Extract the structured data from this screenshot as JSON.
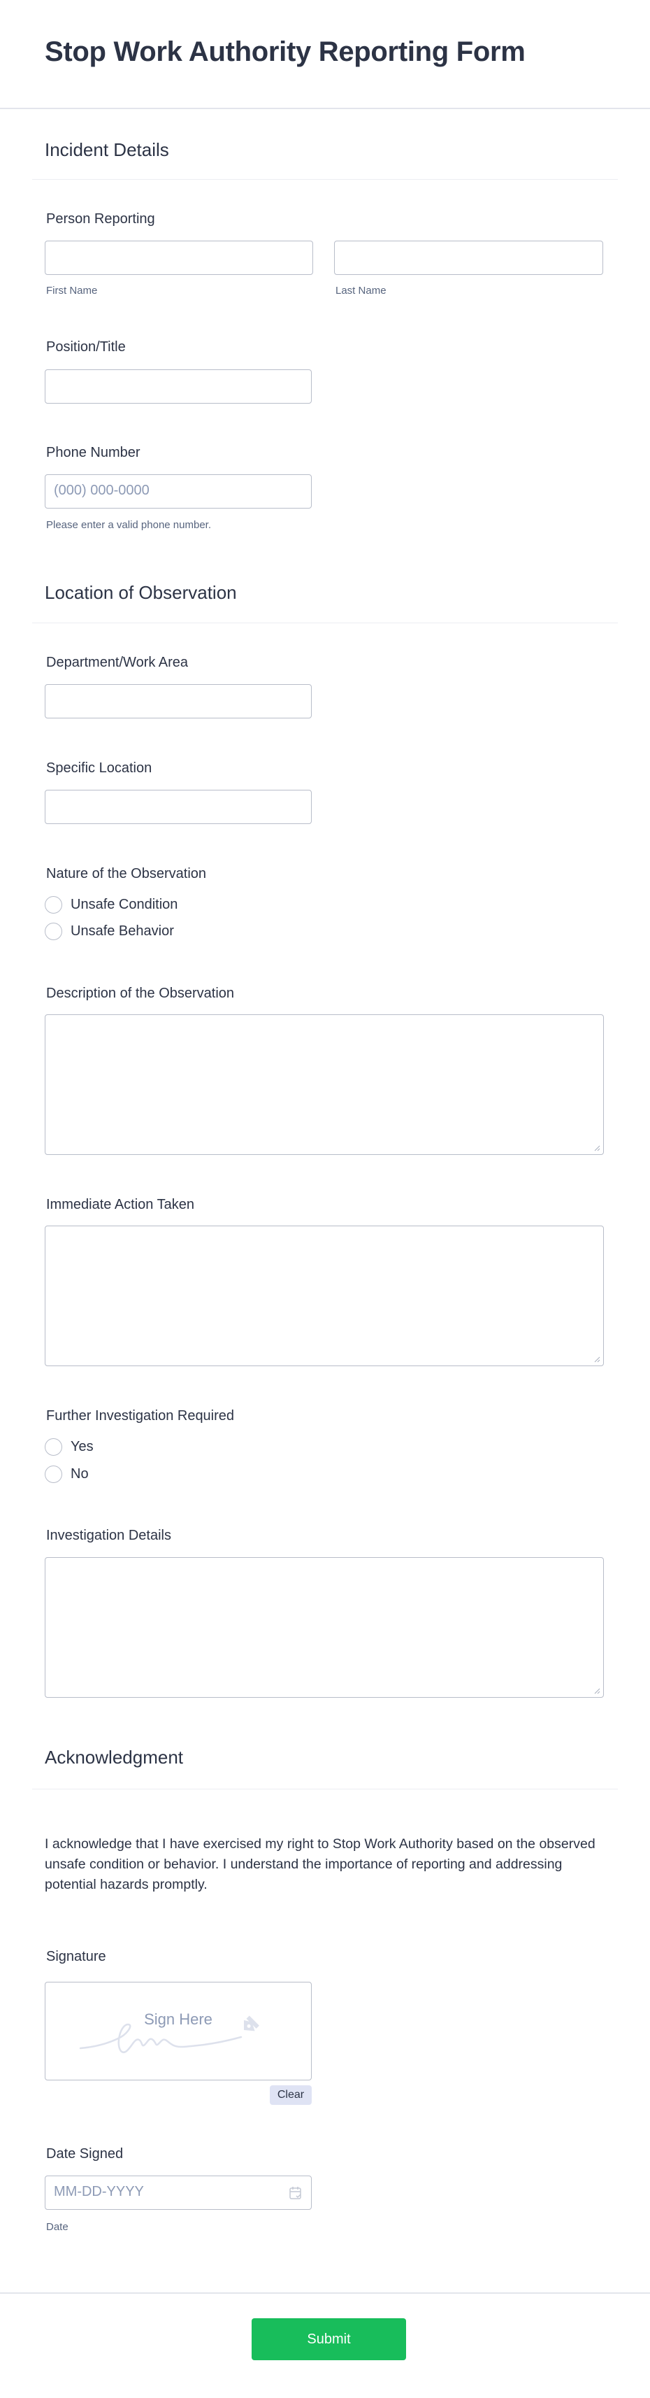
{
  "form": {
    "title": "Stop Work Authority Reporting Form"
  },
  "sections": {
    "incident": {
      "title": "Incident Details"
    },
    "location": {
      "title": "Location of Observation"
    },
    "acknowledgment": {
      "title": "Acknowledgment"
    }
  },
  "fields": {
    "person_reporting": {
      "label": "Person Reporting",
      "first_name": {
        "value": "",
        "sublabel": "First Name"
      },
      "last_name": {
        "value": "",
        "sublabel": "Last Name"
      }
    },
    "position_title": {
      "label": "Position/Title",
      "value": ""
    },
    "phone_number": {
      "label": "Phone Number",
      "value": "",
      "placeholder": "(000) 000-0000",
      "help": "Please enter a valid phone number."
    },
    "department": {
      "label": "Department/Work Area",
      "value": ""
    },
    "specific_location": {
      "label": "Specific Location",
      "value": ""
    },
    "nature": {
      "label": "Nature of the Observation",
      "options": [
        "Unsafe Condition",
        "Unsafe Behavior"
      ],
      "selected": null
    },
    "description": {
      "label": "Description of the Observation",
      "value": ""
    },
    "immediate_action": {
      "label": "Immediate Action Taken",
      "value": ""
    },
    "further_investigation": {
      "label": "Further Investigation Required",
      "options": [
        "Yes",
        "No"
      ],
      "selected": null
    },
    "investigation_details": {
      "label": "Investigation Details",
      "value": ""
    },
    "acknowledgment_text": "I acknowledge that I have exercised my right to Stop Work Authority based on the observed unsafe condition or behavior. I understand the importance of reporting and addressing potential hazards promptly.",
    "signature": {
      "label": "Signature",
      "placeholder": "Sign Here",
      "clear_label": "Clear"
    },
    "date_signed": {
      "label": "Date Signed",
      "value": "",
      "placeholder": "MM-DD-YYYY",
      "sublabel": "Date"
    }
  },
  "footer": {
    "submit_label": "Submit"
  },
  "colors": {
    "submit": "#18bd5b",
    "text": "#2c3345",
    "sublabel": "#57647e",
    "placeholder": "#8d9ab5",
    "border": "#b8bdc9",
    "clear_button_bg": "#dfe3f4"
  }
}
